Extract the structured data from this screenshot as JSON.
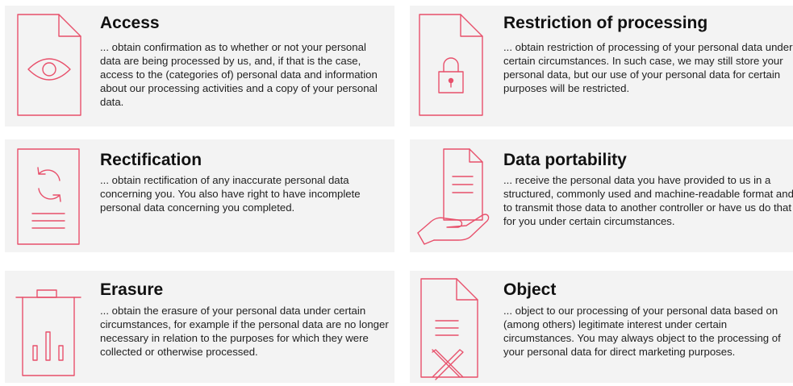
{
  "colors": {
    "accent": "#e8506b",
    "card_background": "#f3f3f3",
    "text": "#1a1a1a"
  },
  "cards": [
    {
      "icon": "document-eye-icon",
      "title": "Access",
      "text": "... obtain confirmation as to whether or not your personal data are being processed by us, and, if that is the case, access to the (categories of) personal data and information about our processing activities and a copy of your personal data."
    },
    {
      "icon": "document-lock-icon",
      "title": "Restriction of processing",
      "text": "... obtain restriction of processing of your personal data under certain circumstances. In such case, we may still store your personal data, but our use of your personal data for certain purposes will be restricted."
    },
    {
      "icon": "document-refresh-icon",
      "title": "Rectification",
      "text": "... obtain rectification of any inaccurate personal data concerning you. You also have right to have incomplete personal data concerning you completed."
    },
    {
      "icon": "hand-document-icon",
      "title": "Data portability",
      "text": "... receive the personal data you have provided to us in a structured, commonly used and machine-readable format and to transmit those data to another controller or have us do that for you under certain circumstances."
    },
    {
      "icon": "trash-bin-icon",
      "title": "Erasure",
      "text": "... obtain the erasure of your personal data under certain circumstances, for example if the personal data are no longer necessary in relation to the purposes for which they were collected or otherwise processed."
    },
    {
      "icon": "document-cross-icon",
      "title": "Object",
      "text": "... object to our processing of your personal data based on (among others) legitimate interest under certain circumstances. You may always object to the processing of your personal data for direct marketing purposes."
    }
  ]
}
